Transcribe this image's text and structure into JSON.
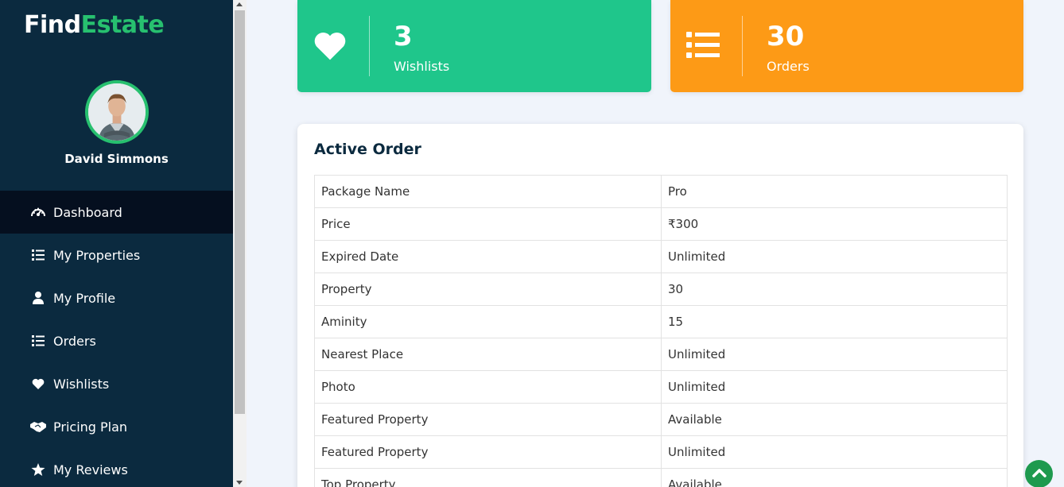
{
  "brand": {
    "part1": "Find",
    "part2": "Estate"
  },
  "user": {
    "name": "David Simmons"
  },
  "menu": [
    {
      "label": "Dashboard",
      "icon": "gauge-icon",
      "active": true
    },
    {
      "label": "My Properties",
      "icon": "list-icon"
    },
    {
      "label": "My Profile",
      "icon": "user-icon"
    },
    {
      "label": "Orders",
      "icon": "list-icon"
    },
    {
      "label": "Wishlists",
      "icon": "heart-icon"
    },
    {
      "label": "Pricing Plan",
      "icon": "handshake-icon"
    },
    {
      "label": "My Reviews",
      "icon": "star-icon"
    }
  ],
  "stats": {
    "wishlists": {
      "value": "3",
      "label": "Wishlists",
      "color": "#1fc68b"
    },
    "orders": {
      "value": "30",
      "label": "Orders",
      "color": "#fd9a16"
    }
  },
  "active_order": {
    "title": "Active Order",
    "rows": [
      {
        "label": "Package Name",
        "value": "Pro"
      },
      {
        "label": "Price",
        "value": "₹300"
      },
      {
        "label": "Expired Date",
        "value": "Unlimited"
      },
      {
        "label": "Property",
        "value": "30"
      },
      {
        "label": "Aminity",
        "value": "15"
      },
      {
        "label": "Nearest Place",
        "value": "Unlimited"
      },
      {
        "label": "Photo",
        "value": "Unlimited"
      },
      {
        "label": "Featured Property",
        "value": "Available"
      },
      {
        "label": "Featured Property",
        "value": "Unlimited"
      },
      {
        "label": "Top Property",
        "value": "Available"
      }
    ]
  },
  "colors": {
    "sidebar": "#0b2a3f",
    "accent_green": "#27c06f",
    "active_item": "#050f1f"
  }
}
